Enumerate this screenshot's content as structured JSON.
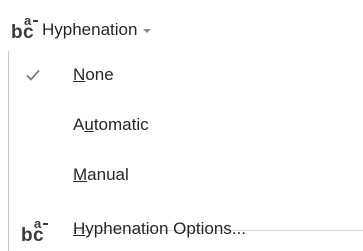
{
  "ribbon": {
    "button_label": "Hyphenation",
    "icon": "hyphenation-icon",
    "icon_glyphs": {
      "b": "b",
      "c": "c",
      "a": "a"
    }
  },
  "menu": {
    "items": [
      {
        "pre": "",
        "accel": "N",
        "post": "one",
        "checked": true
      },
      {
        "pre": "A",
        "accel": "u",
        "post": "tomatic",
        "checked": false
      },
      {
        "pre": "",
        "accel": "M",
        "post": "anual",
        "checked": false
      }
    ],
    "options": {
      "pre": "",
      "accel": "H",
      "post": "yphenation Options...",
      "icon": "hyphenation-options-icon"
    }
  },
  "colors": {
    "text": "#262626",
    "check": "#7a7a7a",
    "separator": "#d4d4d4"
  }
}
